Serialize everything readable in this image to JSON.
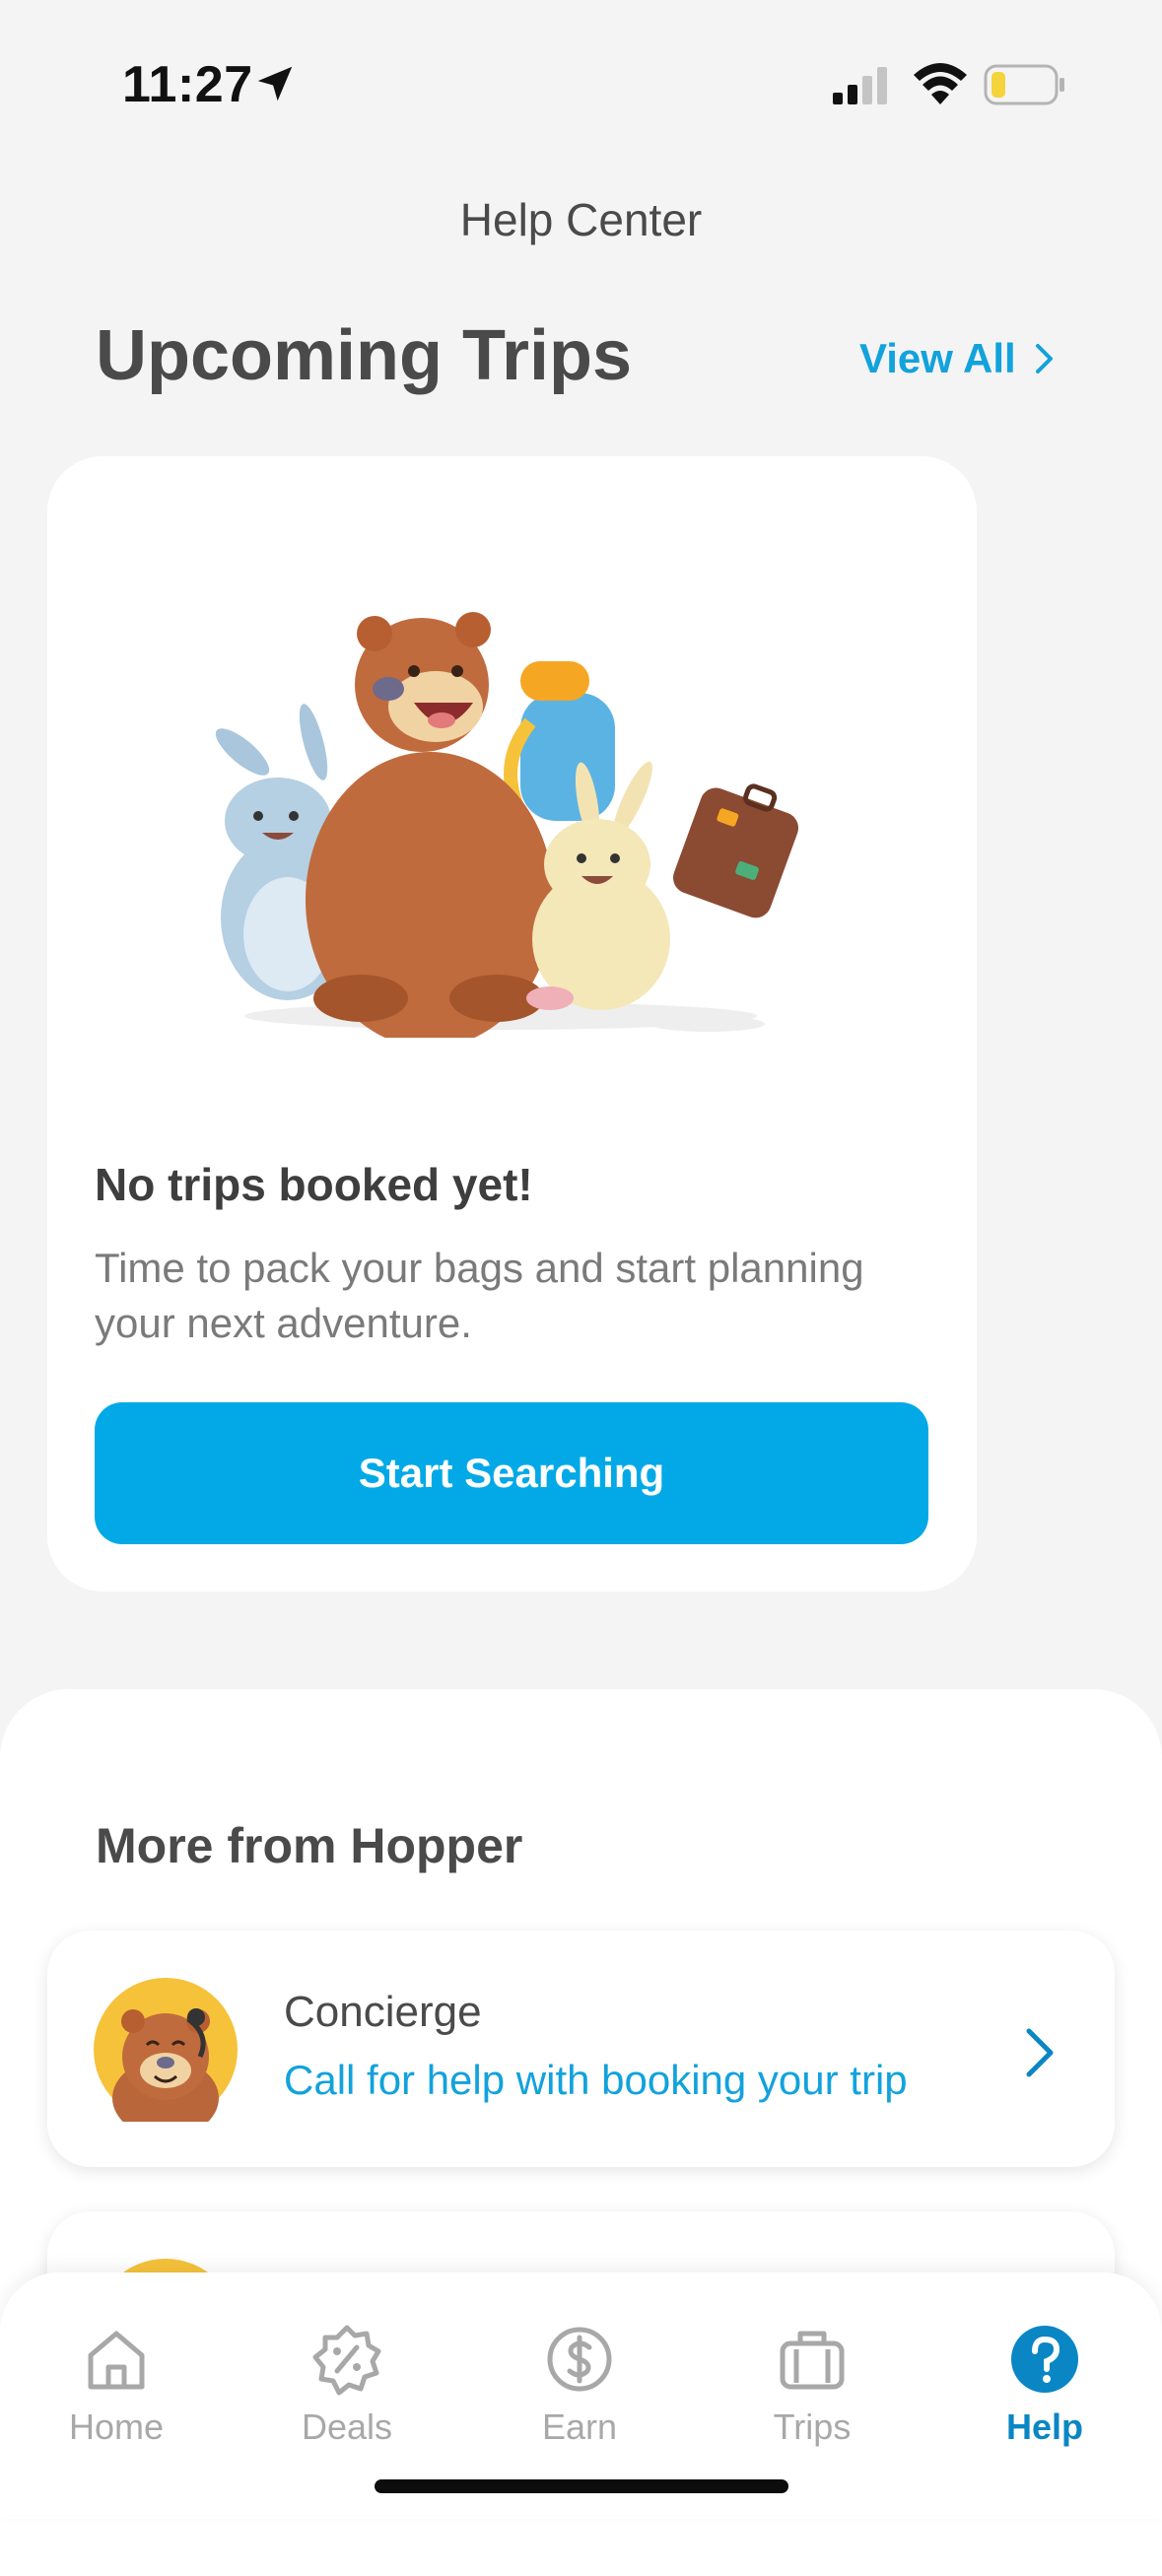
{
  "status_bar": {
    "time": "11:27",
    "battery_color": "#f5d33b"
  },
  "header": {
    "title": "Help Center"
  },
  "upcoming": {
    "title": "Upcoming Trips",
    "view_all": "View All",
    "empty_title": "No trips booked yet!",
    "empty_desc": "Time to pack your bags and start planning your next adventure.",
    "cta": "Start Searching"
  },
  "more": {
    "title": "More from Hopper",
    "items": [
      {
        "title": "Concierge",
        "subtitle": "Call for help with booking your trip"
      }
    ]
  },
  "tabs": [
    {
      "label": "Home",
      "icon": "home-icon",
      "active": false
    },
    {
      "label": "Deals",
      "icon": "deals-icon",
      "active": false
    },
    {
      "label": "Earn",
      "icon": "earn-icon",
      "active": false
    },
    {
      "label": "Trips",
      "icon": "trips-icon",
      "active": false
    },
    {
      "label": "Help",
      "icon": "help-icon",
      "active": true
    }
  ],
  "colors": {
    "accent": "#03a9e6",
    "link": "#12a2dc",
    "active_tab": "#0a86c4"
  }
}
